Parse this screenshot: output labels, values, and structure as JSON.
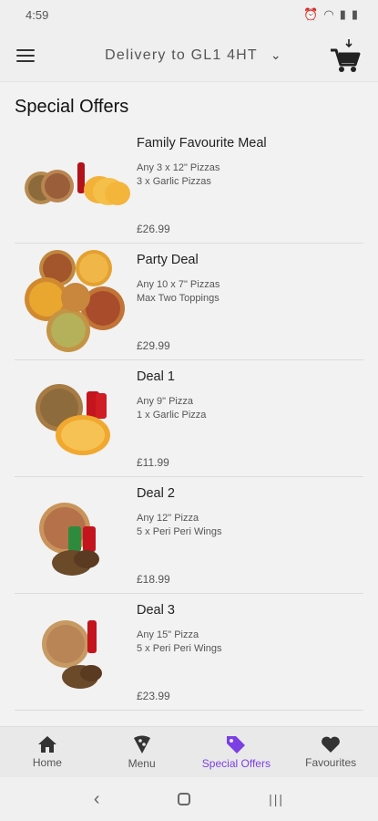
{
  "status": {
    "time": "4:59"
  },
  "header": {
    "delivery_label": "Delivery to GL1 4HT"
  },
  "page": {
    "title": "Special Offers"
  },
  "offers": [
    {
      "name": "Family Favourite Meal",
      "line1": "Any 3 x 12\" Pizzas",
      "line2": "3 x Garlic Pizzas",
      "price": "£26.99"
    },
    {
      "name": "Party Deal",
      "line1": "Any 10 x 7\" Pizzas",
      "line2": "Max Two Toppings",
      "price": "£29.99"
    },
    {
      "name": "Deal 1",
      "line1": "Any 9\" Pizza",
      "line2": "1 x Garlic Pizza",
      "price": "£11.99"
    },
    {
      "name": "Deal 2",
      "line1": "Any 12\" Pizza",
      "line2": "5 x Peri Peri Wings",
      "price": "£18.99"
    },
    {
      "name": "Deal 3",
      "line1": "Any 15\" Pizza",
      "line2": "5 x Peri Peri Wings",
      "price": "£23.99"
    }
  ],
  "nav": {
    "home": "Home",
    "menu": "Menu",
    "offers": "Special Offers",
    "favourites": "Favourites"
  },
  "colors": {
    "accent": "#7b3fe4"
  }
}
